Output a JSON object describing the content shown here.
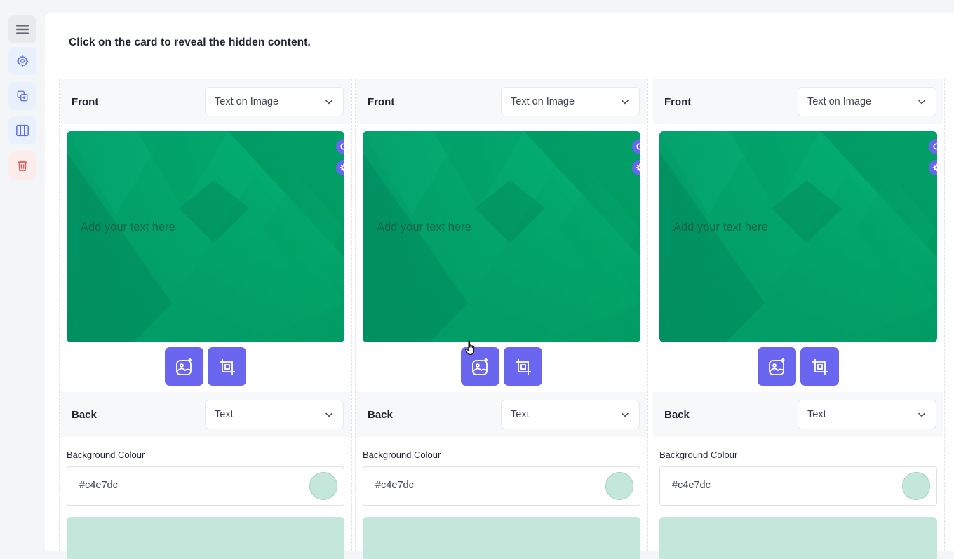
{
  "instructions": "Click on the card to reveal the hidden content.",
  "sidebar": {
    "items": [
      {
        "icon": "menu-icon",
        "bg": "#e9eaee",
        "color": "#666b78"
      },
      {
        "icon": "gear-icon",
        "bg": "#eaf1fe",
        "color": "#5b6cf0"
      },
      {
        "icon": "duplicate-icon",
        "bg": "#eaf1fe",
        "color": "#5b6cf0"
      },
      {
        "icon": "columns-icon",
        "bg": "#eaf1fe",
        "color": "#5b6cf0"
      },
      {
        "icon": "trash-icon",
        "bg": "#fdecec",
        "color": "#e05a5a"
      }
    ]
  },
  "colors": {
    "accent": "#6b66f0",
    "image_green": "#03b875",
    "back_colour": "#c4e7dc"
  },
  "cards": [
    {
      "front": {
        "label": "Front",
        "type": "Text on Image",
        "image_text": "Add your text here"
      },
      "back": {
        "label": "Back",
        "type": "Text"
      },
      "background_colour_label": "Background Colour",
      "background_colour_value": "#c4e7dc"
    },
    {
      "front": {
        "label": "Front",
        "type": "Text on Image",
        "image_text": "Add your text here"
      },
      "back": {
        "label": "Back",
        "type": "Text"
      },
      "background_colour_label": "Background Colour",
      "background_colour_value": "#c4e7dc"
    },
    {
      "front": {
        "label": "Front",
        "type": "Text on Image",
        "image_text": "Add your text here"
      },
      "back": {
        "label": "Back",
        "type": "Text"
      },
      "background_colour_label": "Background Colour",
      "background_colour_value": "#c4e7dc"
    }
  ]
}
